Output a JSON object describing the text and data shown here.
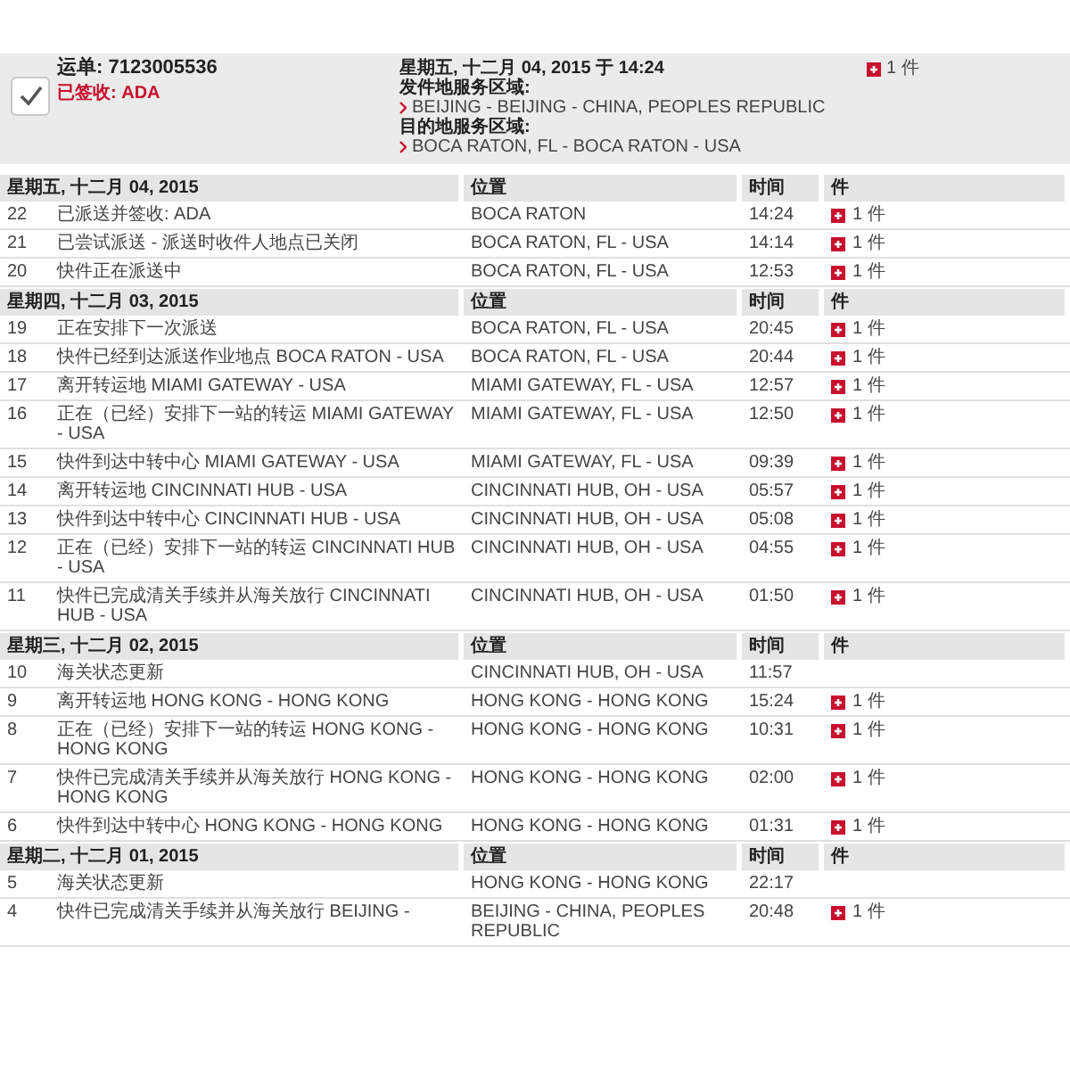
{
  "shipment": {
    "waybill": "运单: 7123005536",
    "status": "已签收: ADA",
    "delivered": true,
    "datetime": "星期五, 十二月 04, 2015 于 14:24",
    "origin_label": "发件地服务区域:",
    "origin": "BEIJING - BEIJING - CHINA, PEOPLES REPUBLIC",
    "destination_label": "目的地服务区域:",
    "destination": "BOCA RATON, FL - BOCA RATON - USA",
    "pieces": "1 件"
  },
  "groups": [
    {
      "date": "星期五, 十二月 04, 2015",
      "columns": [
        "位置",
        "时间",
        "件"
      ],
      "rows": [
        {
          "number": "22",
          "event": "已派送并签收: ADA",
          "location": "BOCA RATON",
          "time": "14:24",
          "pieces": "1 件"
        },
        {
          "number": "21",
          "event": "已尝试派送 - 派送时收件人地点已关闭",
          "location": "BOCA RATON, FL - USA",
          "time": "14:14",
          "pieces": "1 件"
        },
        {
          "number": "20",
          "event": "快件正在派送中",
          "location": "BOCA RATON, FL - USA",
          "time": "12:53",
          "pieces": "1 件"
        }
      ]
    },
    {
      "date": "星期四, 十二月 03, 2015",
      "columns": [
        "位置",
        "时间",
        "件"
      ],
      "rows": [
        {
          "number": "19",
          "event": "正在安排下一次派送",
          "location": "BOCA RATON, FL - USA",
          "time": "20:45",
          "pieces": "1 件"
        },
        {
          "number": "18",
          "event": "快件已经到达派送作业地点 BOCA RATON - USA",
          "location": "BOCA RATON, FL - USA",
          "time": "20:44",
          "pieces": "1 件"
        },
        {
          "number": "17",
          "event": "离开转运地 MIAMI GATEWAY - USA",
          "location": "MIAMI GATEWAY, FL - USA",
          "time": "12:57",
          "pieces": "1 件"
        },
        {
          "number": "16",
          "event": "正在（已经）安排下一站的转运 MIAMI GATEWAY - USA",
          "location": "MIAMI GATEWAY, FL - USA",
          "time": "12:50",
          "pieces": "1 件"
        },
        {
          "number": "15",
          "event": "快件到达中转中心 MIAMI GATEWAY - USA",
          "location": "MIAMI GATEWAY, FL - USA",
          "time": "09:39",
          "pieces": "1 件"
        },
        {
          "number": "14",
          "event": "离开转运地 CINCINNATI HUB - USA",
          "location": "CINCINNATI HUB, OH - USA",
          "time": "05:57",
          "pieces": "1 件"
        },
        {
          "number": "13",
          "event": "快件到达中转中心 CINCINNATI HUB - USA",
          "location": "CINCINNATI HUB, OH - USA",
          "time": "05:08",
          "pieces": "1 件"
        },
        {
          "number": "12",
          "event": "正在（已经）安排下一站的转运 CINCINNATI HUB - USA",
          "location": "CINCINNATI HUB, OH - USA",
          "time": "04:55",
          "pieces": "1 件"
        },
        {
          "number": "11",
          "event": "快件已完成清关手续并从海关放行 CINCINNATI HUB - USA",
          "location": "CINCINNATI HUB, OH - USA",
          "time": "01:50",
          "pieces": "1 件"
        }
      ]
    },
    {
      "date": "星期三, 十二月 02, 2015",
      "columns": [
        "位置",
        "时间",
        "件"
      ],
      "rows": [
        {
          "number": "10",
          "event": "海关状态更新",
          "location": "CINCINNATI HUB, OH - USA",
          "time": "11:57"
        },
        {
          "number": "9",
          "event": "离开转运地 HONG KONG - HONG KONG",
          "location": "HONG KONG - HONG KONG",
          "time": "15:24",
          "pieces": "1 件"
        },
        {
          "number": "8",
          "event": "正在（已经）安排下一站的转运 HONG KONG - HONG KONG",
          "location": "HONG KONG - HONG KONG",
          "time": "10:31",
          "pieces": "1 件"
        },
        {
          "number": "7",
          "event": "快件已完成清关手续并从海关放行 HONG KONG - HONG KONG",
          "location": "HONG KONG - HONG KONG",
          "time": "02:00",
          "pieces": "1 件"
        },
        {
          "number": "6",
          "event": "快件到达中转中心 HONG KONG - HONG KONG",
          "location": "HONG KONG - HONG KONG",
          "time": "01:31",
          "pieces": "1 件"
        }
      ]
    },
    {
      "date": "星期二, 十二月 01, 2015",
      "columns": [
        "位置",
        "时间",
        "件"
      ],
      "rows": [
        {
          "number": "5",
          "event": "海关状态更新",
          "location": "HONG KONG - HONG KONG",
          "time": "22:17"
        },
        {
          "number": "4",
          "event": "快件已完成清关手续并从海关放行 BEIJING -",
          "location": "BEIJING - CHINA, PEOPLES REPUBLIC",
          "time": "20:48",
          "pieces": "1 件"
        }
      ]
    }
  ]
}
